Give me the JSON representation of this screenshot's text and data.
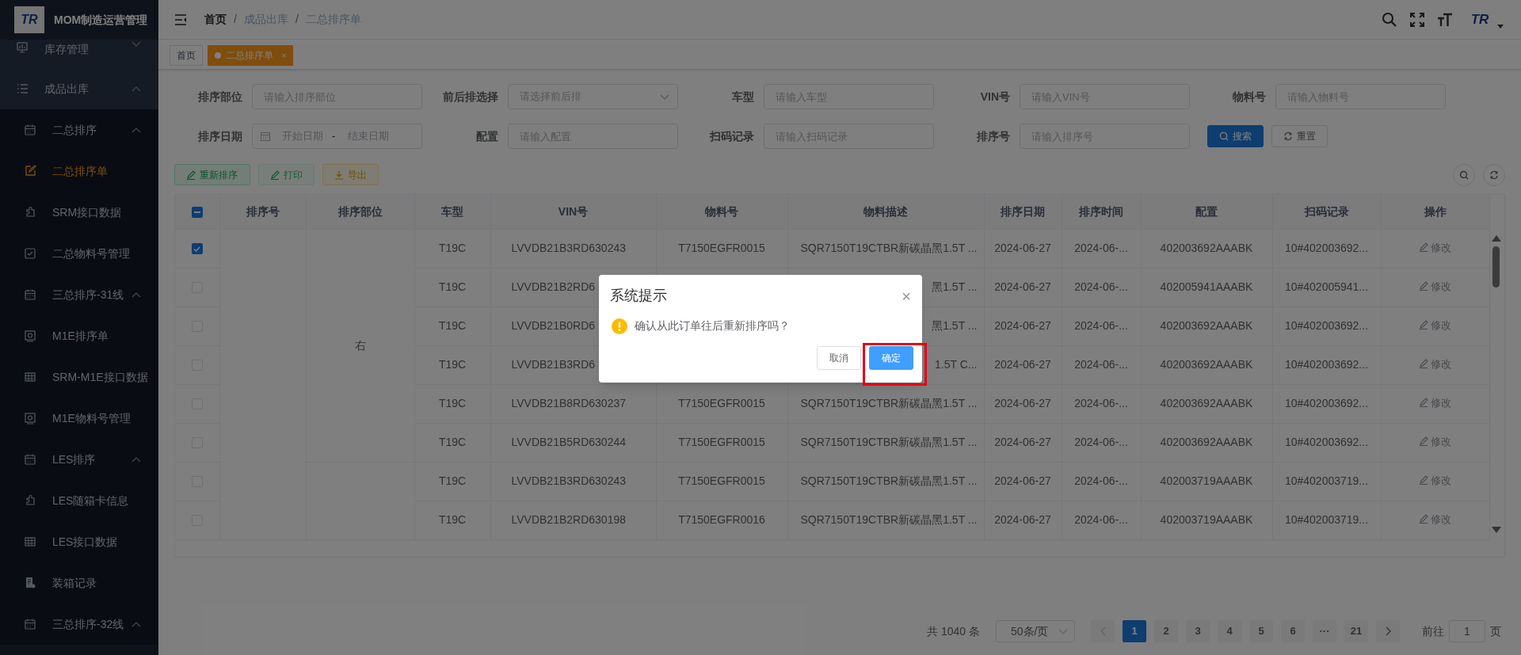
{
  "sidebar": {
    "logo_mark": "TR",
    "title": "MOM制造运营管理",
    "items": [
      {
        "label": "库存管理",
        "expanded": false
      },
      {
        "label": "成品出库",
        "expanded": true,
        "children": [
          {
            "label": "二总排序",
            "expanded": true,
            "children": [
              {
                "label": "二总排序单",
                "selected": true
              },
              {
                "label": "SRM接口数据",
                "selected": false
              },
              {
                "label": "二总物料号管理",
                "selected": false
              }
            ]
          },
          {
            "label": "三总排序-31线",
            "expanded": true,
            "children": [
              {
                "label": "M1E排序单",
                "selected": false
              },
              {
                "label": "SRM-M1E接口数据",
                "selected": false
              },
              {
                "label": "M1E物料号管理",
                "selected": false
              }
            ]
          },
          {
            "label": "LES排序",
            "expanded": true,
            "children": [
              {
                "label": "LES随箱卡信息",
                "selected": false
              },
              {
                "label": "LES接口数据",
                "selected": false
              }
            ]
          },
          {
            "label": "装箱记录",
            "selected": false
          },
          {
            "label": "三总排序-32线",
            "expanded": true
          }
        ]
      }
    ]
  },
  "header": {
    "breadcrumb": [
      "首页",
      "成品出库",
      "二总排序单"
    ],
    "breadcrumb_separator": "/",
    "avatar_mark": "TR"
  },
  "tabs": [
    {
      "label": "首页",
      "selected": false
    },
    {
      "label": "二总排序单",
      "selected": true,
      "close": "×"
    }
  ],
  "filters": [
    {
      "label": "排序部位",
      "kind": "input",
      "placeholder": "请输入排序部位"
    },
    {
      "label": "前后排选择",
      "kind": "select",
      "placeholder": "请选择前后排"
    },
    {
      "label": "车型",
      "kind": "input",
      "placeholder": "请输入车型"
    },
    {
      "label": "VIN号",
      "kind": "input",
      "placeholder": "请输入VIN号"
    },
    {
      "label": "物料号",
      "kind": "input",
      "placeholder": "请输入物料号"
    },
    {
      "label": "排序日期",
      "kind": "daterange",
      "start_placeholder": "开始日期",
      "separator": "-",
      "end_placeholder": "结束日期"
    },
    {
      "label": "配置",
      "kind": "input",
      "placeholder": "请输入配置"
    },
    {
      "label": "扫码记录",
      "kind": "input",
      "placeholder": "请输入扫码记录"
    },
    {
      "label": "排序号",
      "kind": "input",
      "placeholder": "请输入排序号"
    }
  ],
  "filter_buttons": [
    {
      "label": "搜索",
      "kind": "primary"
    },
    {
      "label": "重置",
      "kind": "default"
    }
  ],
  "actions": [
    {
      "label": "重新排序",
      "kind": "success",
      "disabled": false
    },
    {
      "label": "打印",
      "kind": "success",
      "disabled": true
    },
    {
      "label": "导出",
      "kind": "warning",
      "disabled": false
    }
  ],
  "table": {
    "header_checkbox": {
      "indeterminate": true
    },
    "columns": [
      "排序号",
      "排序部位",
      "车型",
      "VIN号",
      "物料号",
      "物料描述",
      "排序日期",
      "排序时间",
      "配置",
      "扫码记录",
      "操作"
    ],
    "groups": [
      {
        "position": "右",
        "rows": [
          {
            "checked": true,
            "model": "T19C",
            "vin": "LVVDB21B3RD630243",
            "part_no": "T7150EGFR0015",
            "description": "SQR7150T19CTBR新碳晶黑1.5T ...",
            "date": "2024-06-27",
            "time": "2024-06-...",
            "config": "402003692AAABK",
            "scan": "10#402003692...",
            "action": "修改"
          },
          {
            "checked": false,
            "model": "T19C",
            "vin": "LVVDB21B2RD6",
            "description": "黑1.5T ...",
            "date": "2024-06-27",
            "time": "2024-06-...",
            "config": "402005941AAABK",
            "scan": "10#402005941...",
            "action": "修改"
          },
          {
            "checked": false,
            "model": "T19C",
            "vin": "LVVDB21B0RD6",
            "description": "黑1.5T ...",
            "date": "2024-06-27",
            "time": "2024-06-...",
            "config": "402003692AAABK",
            "scan": "10#402003692...",
            "action": "修改"
          },
          {
            "checked": false,
            "model": "T19C",
            "vin": "LVVDB21B3RD6",
            "description": "1.5T C...",
            "date": "2024-06-27",
            "time": "2024-06-...",
            "config": "402003692AAABK",
            "scan": "10#402003692...",
            "action": "修改"
          },
          {
            "checked": false,
            "model": "T19C",
            "vin": "LVVDB21B8RD630237",
            "part_no": "T7150EGFR0015",
            "description": "SQR7150T19CTBR新碳晶黑1.5T ...",
            "date": "2024-06-27",
            "time": "2024-06-...",
            "config": "402003692AAABK",
            "scan": "10#402003692...",
            "action": "修改"
          },
          {
            "checked": false,
            "model": "T19C",
            "vin": "LVVDB21B5RD630244",
            "part_no": "T7150EGFR0015",
            "description": "SQR7150T19CTBR新碳晶黑1.5T ...",
            "date": "2024-06-27",
            "time": "2024-06-...",
            "config": "402003692AAABK",
            "scan": "10#402003692...",
            "action": "修改"
          }
        ]
      },
      {
        "rows": [
          {
            "checked": false,
            "model": "T19C",
            "vin": "LVVDB21B3RD630243",
            "part_no": "T7150EGFR0015",
            "description": "SQR7150T19CTBR新碳晶黑1.5T ...",
            "date": "2024-06-27",
            "time": "2024-06-...",
            "config": "402003719AAABK",
            "scan": "10#402003719...",
            "action": "修改"
          },
          {
            "checked": false,
            "model": "T19C",
            "vin": "LVVDB21B2RD630198",
            "part_no": "T7150EGFR0016",
            "description": "SQR7150T19CTBR新碳晶黑1.5T ...",
            "date": "2024-06-27",
            "time": "2024-06-...",
            "config": "402003719AAABK",
            "scan": "10#402003719...",
            "action": "修改"
          }
        ]
      }
    ]
  },
  "pagination": {
    "total": "共 1040 条",
    "page_size": "50条/页",
    "pages": [
      {
        "label": "1",
        "selected": true
      },
      {
        "label": "2",
        "selected": false
      },
      {
        "label": "3",
        "selected": false
      },
      {
        "label": "4",
        "selected": false
      },
      {
        "label": "5",
        "selected": false
      },
      {
        "label": "6",
        "selected": false
      },
      {
        "label": "···",
        "selected": false
      },
      {
        "label": "21",
        "selected": false
      }
    ],
    "goto_label": "前往",
    "goto_value": "1",
    "goto_suffix": "页"
  },
  "dialog": {
    "title": "系统提示",
    "close": "×",
    "message": "确认从此订单往后重新排序吗？",
    "buttons": [
      {
        "label": "取消",
        "kind": "default",
        "highlighted": false
      },
      {
        "label": "确定",
        "kind": "primary",
        "highlighted": true
      }
    ]
  }
}
